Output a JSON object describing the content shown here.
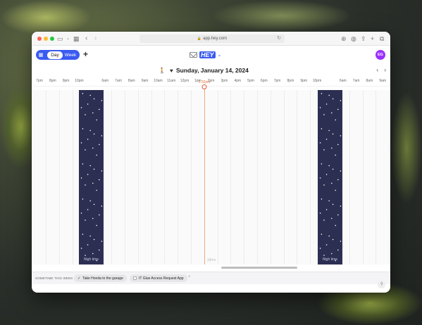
{
  "browser": {
    "url": "app.hey.com"
  },
  "toolbar": {
    "view_day": "Day",
    "view_week": "Week"
  },
  "user": {
    "initials": "EG",
    "avatar_color": "#9b30ff"
  },
  "date_header": {
    "title": "Sunday, January 14, 2024"
  },
  "timeline": {
    "hours_left": [
      "7pm",
      "8pm",
      "9pm",
      "10pm"
    ],
    "hours_mid": [
      "6am",
      "7am",
      "8am",
      "9am",
      "10am",
      "11am",
      "12pm",
      "1pm",
      "2pm",
      "3pm",
      "4pm",
      "5pm",
      "6pm",
      "7pm",
      "8pm",
      "9pm",
      "10pm"
    ],
    "hours_right": [
      "6am",
      "7am",
      "8am",
      "9am"
    ],
    "now_label": "1:32pm",
    "night_label_1": "Nigh time",
    "night_label_2": "Nigh time",
    "ghost_label": "16hrs"
  },
  "sometime": {
    "title": "SOMETIME THIS WEEK",
    "items": [
      {
        "label": "Take Honda to the garage",
        "done": true
      },
      {
        "label": "IT Glue Access Request App",
        "done": false
      }
    ]
  },
  "colors": {
    "accent": "#3a5bf0",
    "night": "#2d2f52",
    "now": "#e3733a"
  },
  "icons": {
    "apps": "grid-icon",
    "add": "plus-icon",
    "help": "question-icon"
  }
}
